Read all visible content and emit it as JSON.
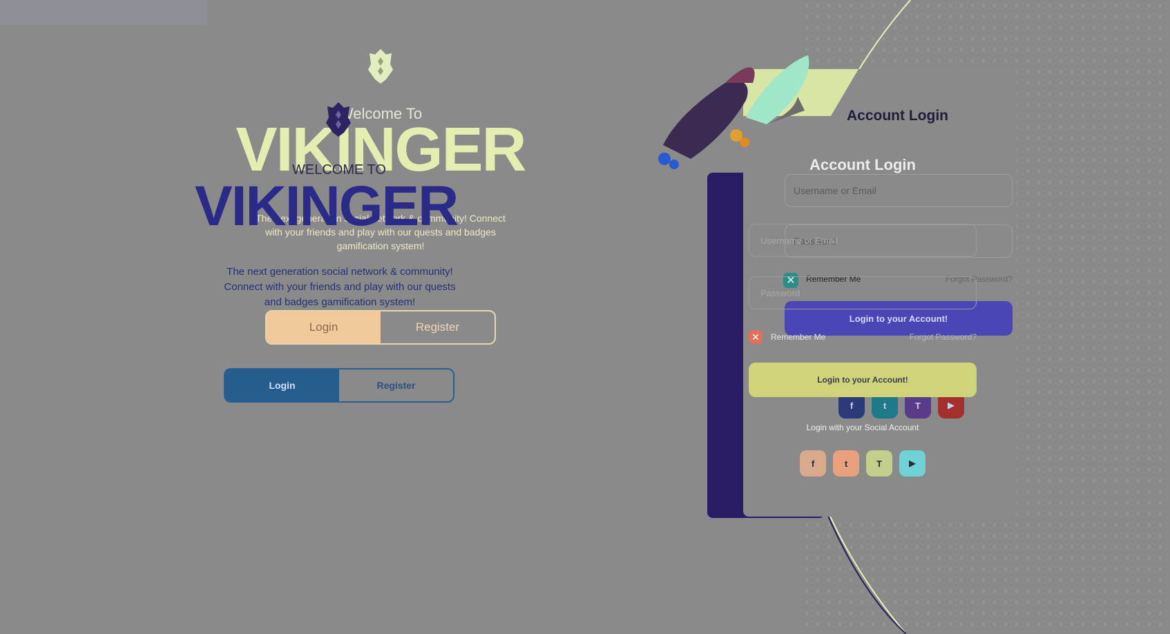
{
  "background": {
    "base": "#8a8a8a",
    "accent": "#2b1a66"
  },
  "ghost": {
    "welcome": "Welcome To",
    "brand": "VIKINGER",
    "tagline": "The next generation social network & community! Connect with your friends and play with our quests and badges gamification system!",
    "tabs": [
      {
        "label": "Login"
      },
      {
        "label": "Register"
      }
    ],
    "form": {
      "title": "Account Login",
      "username_placeholder": "Username or Email",
      "password_placeholder": "Password",
      "remember_label": "Remember Me",
      "forgot_label": "Forgot Password?",
      "submit_label": "Login to your Account!",
      "social_label": "Login with your Social Account",
      "social": [
        {
          "icon": "facebook-icon",
          "glyph": "f",
          "color": "#2a3a7a"
        },
        {
          "icon": "twitter-icon",
          "glyph": "t",
          "color": "#1e7a8a"
        },
        {
          "icon": "twitch-icon",
          "glyph": "T",
          "color": "#5a3a8a"
        },
        {
          "icon": "youtube-icon",
          "glyph": "▶",
          "color": "#a42f2f"
        }
      ]
    }
  },
  "main": {
    "welcome": "WELCOME TO",
    "brand": "VIKINGER",
    "tagline": "The next generation social network & community! Connect with your friends and play with our quests and badges gamification system!",
    "tabs": [
      {
        "label": "Login"
      },
      {
        "label": "Register"
      }
    ],
    "form": {
      "title": "Account Login",
      "username_placeholder": "Username or Email",
      "password_placeholder": "Password",
      "remember_label": "Remember Me",
      "forgot_label": "Forgot Password?",
      "submit_label": "Login to your Account!",
      "social_label": "Login with your Social Account",
      "social": [
        {
          "icon": "facebook-icon",
          "glyph": "f",
          "color": "#d8a98a"
        },
        {
          "icon": "twitter-icon",
          "glyph": "t",
          "color": "#e9a07c"
        },
        {
          "icon": "twitch-icon",
          "glyph": "T",
          "color": "#c2cf8a"
        },
        {
          "icon": "youtube-icon",
          "glyph": "▶",
          "color": "#6fd2d4"
        }
      ]
    }
  }
}
